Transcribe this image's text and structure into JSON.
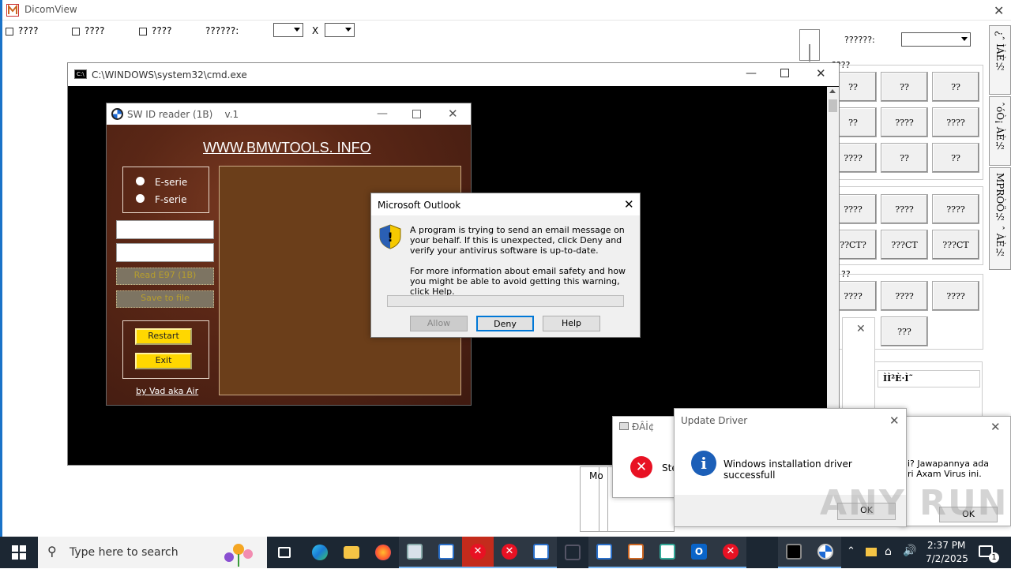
{
  "dicom": {
    "title": "DicomView",
    "toolbar": {
      "checkboxes": [
        "????",
        "????",
        "????"
      ],
      "label": "??????:",
      "x_label": "X",
      "right_label": "??????:"
    },
    "tabs": [
      "¿ˆ ÌÁÈ½",
      "ˆóÒ¡ ÀÈ½",
      "MPRÒÖ½ ˆ ÀÈ½"
    ],
    "group_label": "????",
    "grid1": [
      "??",
      "??",
      "??",
      "??",
      "????",
      "????",
      "????",
      "??",
      "??"
    ],
    "grid2": [
      "????",
      "????",
      "????",
      "??CT?",
      "???CT",
      "???CT"
    ],
    "group2_label": "??",
    "grid3": [
      "????",
      "????",
      "????"
    ],
    "grid3b": [
      "???"
    ],
    "table_header": "ÌÌ²È·Ì˜"
  },
  "cmd": {
    "title": "C:\\WINDOWS\\system32\\cmd.exe"
  },
  "swid": {
    "title": "SW ID reader (1B)    v.1",
    "site": "WWW.BMWTOOLS. INFO",
    "radio1": "E-serie",
    "radio2": "F-serie",
    "btn_read": "Read E97 (1B)",
    "btn_save": "Save to file",
    "btn_restart": "Restart",
    "btn_exit": "Exit",
    "credit": "by Vad aka Air"
  },
  "outlook": {
    "title": "Microsoft Outlook",
    "msg1": "A program is trying to send an email message on your behalf. If this is unexpected, click Deny and verify your antivirus software is up-to-date.",
    "msg2": "For more information about email safety and how you might be able to avoid getting this warning, click Help.",
    "allow": "Allow",
    "deny": "Deny",
    "help": "Help"
  },
  "error_dialog": {
    "title": "ÐÂİ¢",
    "text": "Ste",
    "left_text": "Mo"
  },
  "update_driver": {
    "title": "Update Driver",
    "message": "Windows installation driver successfull",
    "ok": "OK"
  },
  "axam": {
    "text1": "i? Jawapannya ada",
    "text2": "ri Axam Virus ini.",
    "ok": "OK"
  },
  "watermark": "ANY RUN",
  "taskbar": {
    "search_placeholder": "Type here to search",
    "time": "2:37 PM",
    "date": "7/2/2025",
    "notif_count": "1"
  },
  "colors": {
    "accent": "#0078d7",
    "taskbar": "#1c2733",
    "error_red": "#e81123",
    "gold": "#ffd700"
  }
}
